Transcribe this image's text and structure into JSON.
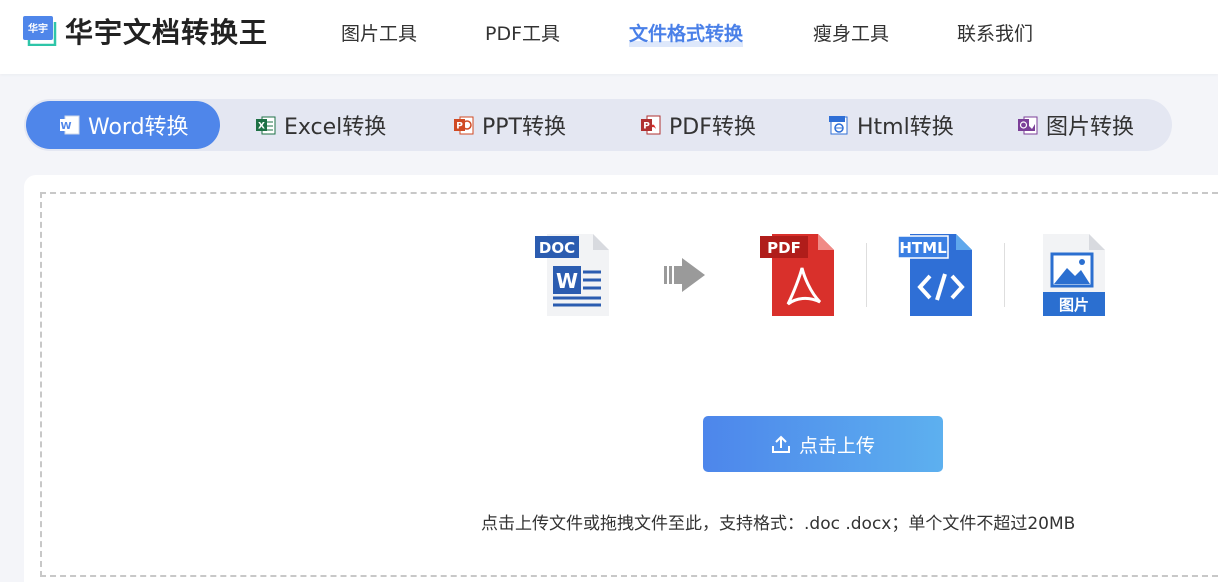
{
  "app": {
    "logo_badge": "华宇",
    "title": "华宇文档转换王"
  },
  "nav": {
    "items": [
      {
        "label": "图片工具",
        "active": false
      },
      {
        "label": "PDF工具",
        "active": false
      },
      {
        "label": "文件格式转换",
        "active": true
      },
      {
        "label": "瘦身工具",
        "active": false
      },
      {
        "label": "联系我们",
        "active": false
      }
    ]
  },
  "tabs": [
    {
      "label": "Word转换",
      "icon": "word-icon",
      "active": true
    },
    {
      "label": "Excel转换",
      "icon": "excel-icon",
      "active": false
    },
    {
      "label": "PPT转换",
      "icon": "ppt-icon",
      "active": false
    },
    {
      "label": "PDF转换",
      "icon": "pdf-icon",
      "active": false
    },
    {
      "label": "Html转换",
      "icon": "html-icon",
      "active": false
    },
    {
      "label": "图片转换",
      "icon": "image-icon",
      "active": false
    }
  ],
  "conversion": {
    "source": {
      "badge": "DOC",
      "icon": "doc-file-icon"
    },
    "arrow": "arrow-right-icon",
    "targets": [
      {
        "badge": "PDF",
        "icon": "pdf-file-icon"
      },
      {
        "badge": "HTML",
        "icon": "html-file-icon"
      },
      {
        "badge": "图片",
        "icon": "image-file-icon"
      }
    ]
  },
  "upload": {
    "button_label": "点击上传",
    "icon": "upload-icon",
    "hint": "点击上传文件或拖拽文件至此，支持格式：.doc .docx；单个文件不超过20MB"
  },
  "colors": {
    "accent": "#4f86ea",
    "tab_bar": "#e4e7f2",
    "word": "#2b5cb0",
    "excel": "#1e7145",
    "ppt": "#d04a23",
    "pdf": "#d9302b",
    "html": "#2f6fd6",
    "image": "#7b3f98"
  }
}
